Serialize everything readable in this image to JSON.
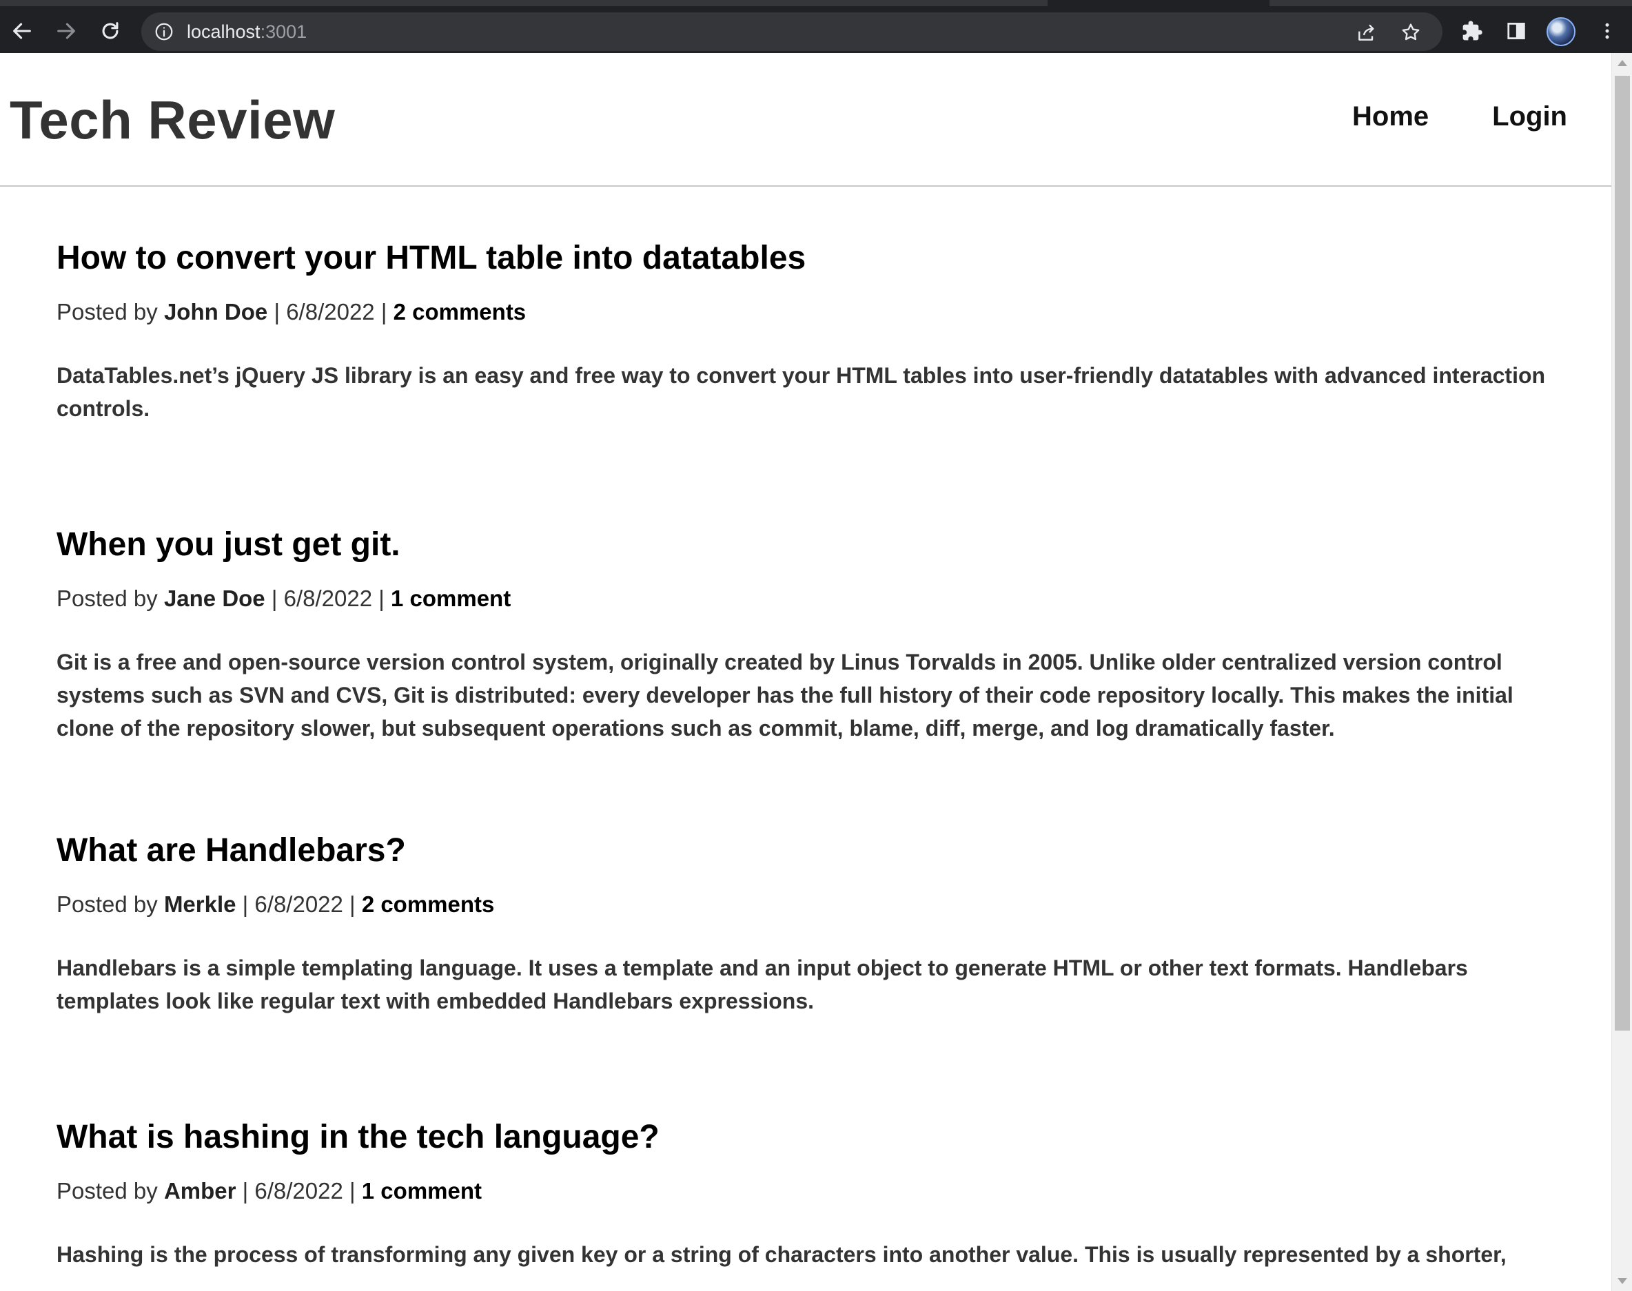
{
  "browser": {
    "url_host": "localhost",
    "url_port": ":3001",
    "icons": {
      "back": "arrow-left-icon",
      "forward": "arrow-right-icon",
      "reload": "reload-icon",
      "site_info": "info-icon",
      "share": "share-icon",
      "bookmark": "star-icon",
      "extensions": "puzzle-icon",
      "side_panel": "side-panel-icon",
      "profile": "avatar",
      "menu": "kebab-menu-icon"
    }
  },
  "header": {
    "site_title": "Tech Review",
    "nav": [
      {
        "label": "Home"
      },
      {
        "label": "Login"
      }
    ]
  },
  "posts": [
    {
      "title": "How to convert your HTML table into datatables",
      "posted_by_label": "Posted by",
      "author": "John Doe",
      "sep1": " | ",
      "date": "6/8/2022",
      "sep2": " | ",
      "comments": "2 comments",
      "body": "DataTables.net’s jQuery JS library is an easy and free way to convert your HTML tables into user-friendly datatables with advanced interaction controls."
    },
    {
      "title": "When you just get git.",
      "posted_by_label": "Posted by",
      "author": "Jane Doe",
      "sep1": " | ",
      "date": "6/8/2022",
      "sep2": " | ",
      "comments": "1 comment",
      "body": "Git is a free and open-source version control system, originally created by Linus Torvalds in 2005. Unlike older centralized version control systems such as SVN and CVS, Git is distributed: every developer has the full history of their code repository locally. This makes the initial clone of the repository slower, but subsequent operations such as commit, blame, diff, merge, and log dramatically faster."
    },
    {
      "title": "What are Handlebars?",
      "posted_by_label": "Posted by",
      "author": "Merkle",
      "sep1": " | ",
      "date": "6/8/2022",
      "sep2": " | ",
      "comments": "2 comments",
      "body": "Handlebars is a simple templating language. It uses a template and an input object to generate HTML or other text formats. Handlebars templates look like regular text with embedded Handlebars expressions."
    },
    {
      "title": "What is hashing in the tech language?",
      "posted_by_label": "Posted by",
      "author": "Amber",
      "sep1": " | ",
      "date": "6/8/2022",
      "sep2": " | ",
      "comments": "1 comment",
      "body": "Hashing is the process of transforming any given key or a string of characters into another value. This is usually represented by a shorter,"
    }
  ]
}
